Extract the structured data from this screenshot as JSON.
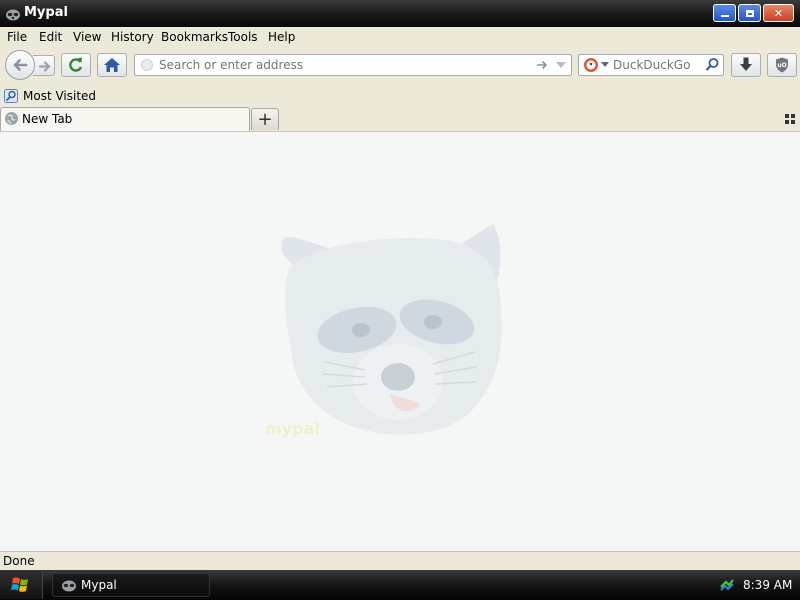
{
  "window": {
    "title": "Mypal"
  },
  "menu": {
    "items": [
      {
        "label": "File"
      },
      {
        "label": "Edit"
      },
      {
        "label": "View"
      },
      {
        "label": "History"
      },
      {
        "label": "Bookmarks"
      },
      {
        "label": "Tools"
      },
      {
        "label": "Help"
      }
    ]
  },
  "navbar": {
    "url_placeholder": "Search or enter address",
    "search_engine": "DuckDuckGo",
    "icons": [
      "back-icon",
      "forward-icon",
      "reload-icon",
      "home-icon",
      "go-arrow-icon",
      "history-dropdown-icon",
      "duckduckgo-icon",
      "search-icon",
      "download-icon",
      "ublock-icon"
    ]
  },
  "bookmarks": {
    "items": [
      {
        "label": "Most Visited"
      }
    ]
  },
  "tabs": [
    {
      "label": "New Tab"
    }
  ],
  "status": {
    "text": "Done"
  },
  "taskbar": {
    "task_label": "Mypal",
    "time": "8:39 AM"
  },
  "colors": {
    "titlebar": "#151515",
    "chrome": "#ece9d8",
    "content": "#f5f6f6",
    "accent": "#2456c8",
    "close": "#c6402a"
  }
}
